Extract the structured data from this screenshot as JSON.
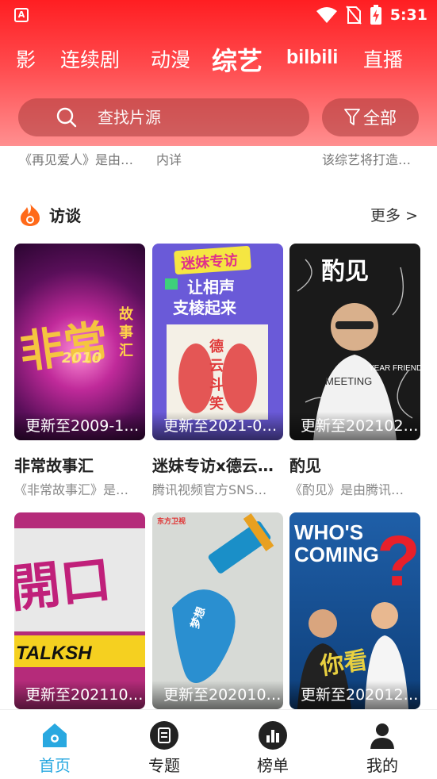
{
  "statusbar": {
    "time": "5:31",
    "app_glyph": "A"
  },
  "tabs": [
    {
      "label": "影",
      "active": false
    },
    {
      "label": "连续剧",
      "active": false
    },
    {
      "label": "动漫",
      "active": false
    },
    {
      "label": "综艺",
      "active": true
    },
    {
      "label": "bilbili",
      "active": false
    },
    {
      "label": "直播",
      "active": false
    }
  ],
  "search": {
    "placeholder": "查找片源",
    "filter_label": "全部"
  },
  "peek": [
    "《再见爱人》是由…",
    "内详",
    "该综艺将打造…"
  ],
  "section": {
    "title": "访谈",
    "more": "更多 >",
    "icon": "flame-icon"
  },
  "cards": [
    {
      "caption": "更新至2009-1…",
      "title": "非常故事汇",
      "desc": "《非常故事汇》是…",
      "poster_text": "非常 故事汇 2010"
    },
    {
      "caption": "更新至2021-0…",
      "title": "迷妹专访x德云…",
      "desc": "腾讯视频官方SNS…",
      "poster_text": "迷妹专访 让相声支棱起来 德云斗笑社"
    },
    {
      "caption": "更新至202102…",
      "title": "酌见",
      "desc": "《酌见》是由腾讯…",
      "poster_text": "酌见"
    },
    {
      "caption": "更新至2021102.0",
      "title": "",
      "desc": "",
      "poster_text": "TALKSH"
    },
    {
      "caption": "更新至202010…",
      "title": "",
      "desc": "",
      "poster_text": "东方卫视"
    },
    {
      "caption": "更新至202012…",
      "title": "",
      "desc": "",
      "poster_text": "WHO'S COMING"
    }
  ],
  "bottom_nav": [
    {
      "label": "首页",
      "icon": "home-icon",
      "active": true
    },
    {
      "label": "专题",
      "icon": "document-icon",
      "active": false
    },
    {
      "label": "榜单",
      "icon": "chart-icon",
      "active": false
    },
    {
      "label": "我的",
      "icon": "user-icon",
      "active": false
    }
  ],
  "colors": {
    "header_red": "#ff1e22",
    "nav_active": "#29a8e0",
    "section_icon": "#ff6a1a"
  }
}
